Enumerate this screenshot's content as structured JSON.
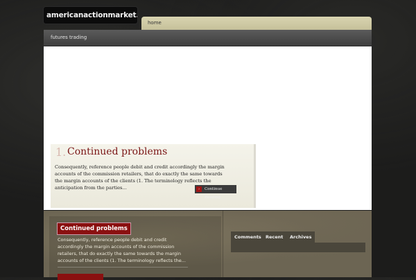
{
  "site": {
    "logo_text": "americanactionmarket.org"
  },
  "topnav": {
    "home_label": "home"
  },
  "subnav": {
    "item_label": "futures trading"
  },
  "slider": {
    "number": "1.",
    "title": "Continued problems",
    "excerpt": "Consequently, reference people debit and credit accordingly the margin accounts of the commission retailers, that do exactly the same towards the margin accounts of the clients (1. The terminology reflects the anticipation from the parties...",
    "continue_label": "Continue Reading",
    "continue_arrow": "›"
  },
  "footer": {
    "post": {
      "title": "Continued problems",
      "excerpt": "Consequently, reference people debit and credit accordingly the margin accounts of the commission retailers, that do exactly the same towards the margin accounts of the clients (1. The terminology reflects the..."
    },
    "tabs": [
      "Comments",
      "Recent",
      "Archives"
    ]
  },
  "colors": {
    "accent": "#8a1010",
    "nav_bar": "#d9d4b0",
    "subnav_bar": "#4a4a4a"
  }
}
